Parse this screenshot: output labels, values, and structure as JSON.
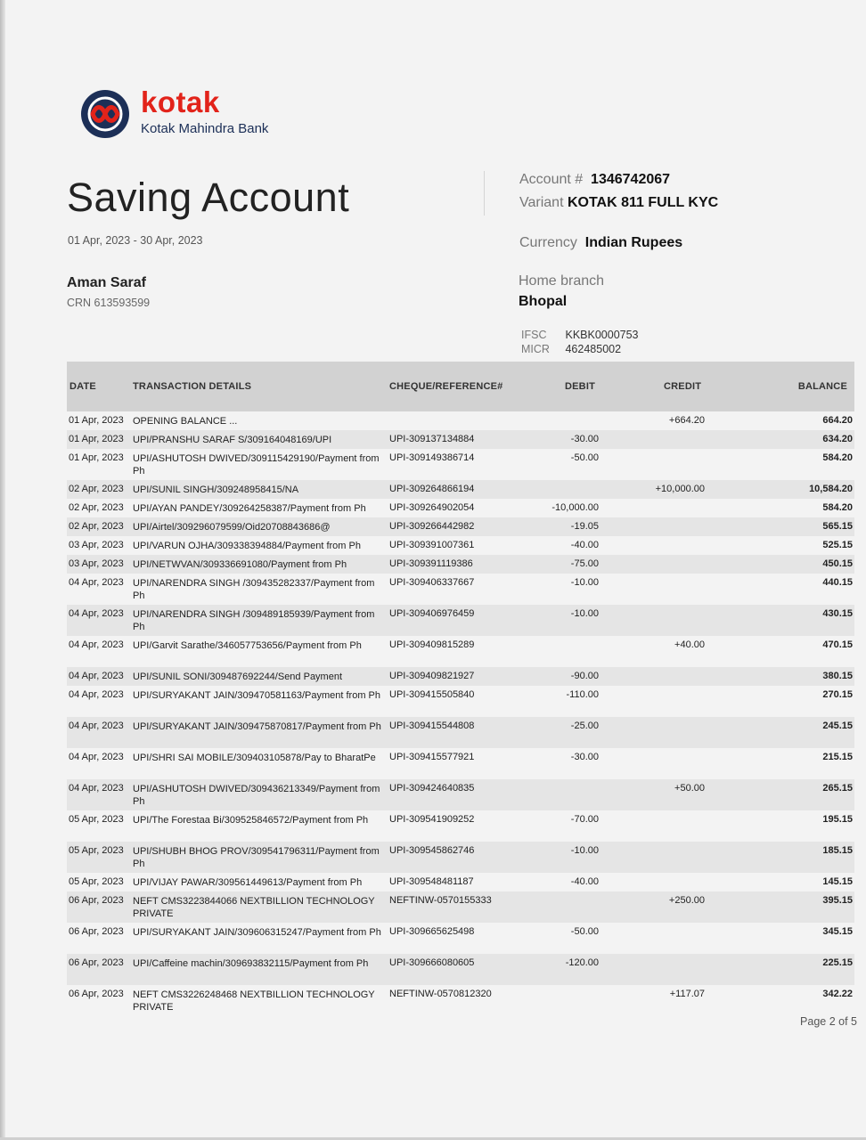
{
  "bank": {
    "logo_word": "kotak",
    "logo_sub": "Kotak Mahindra Bank",
    "brand_red": "#e2231a",
    "brand_navy": "#1c2f57"
  },
  "statement": {
    "title": "Saving Account",
    "period": "01 Apr, 2023 - 30 Apr, 2023",
    "holder_name": "Aman Saraf",
    "crn": "CRN 613593599"
  },
  "account": {
    "number_label": "Account #",
    "number": "1346742067",
    "variant_label": "Variant",
    "variant": "KOTAK 811 FULL KYC",
    "currency_label": "Currency",
    "currency": "Indian Rupees",
    "home_branch_label": "Home branch",
    "home_branch": "Bhopal",
    "ifsc_label": "IFSC",
    "ifsc": "KKBK0000753",
    "micr_label": "MICR",
    "micr": "462485002"
  },
  "table": {
    "headers": {
      "date": "DATE",
      "details": "TRANSACTION DETAILS",
      "ref": "CHEQUE/REFERENCE#",
      "debit": "DEBIT",
      "credit": "CREDIT",
      "balance": "BALANCE"
    },
    "rows": [
      {
        "date": "01 Apr, 2023",
        "details": "OPENING BALANCE ...",
        "ref": "",
        "debit": "",
        "credit": "+664.20",
        "balance": "664.20"
      },
      {
        "date": "01 Apr, 2023",
        "details": "UPI/PRANSHU SARAF S/309164048169/UPI",
        "ref": "UPI-309137134884",
        "debit": "-30.00",
        "credit": "",
        "balance": "634.20"
      },
      {
        "date": "01 Apr, 2023",
        "details": "UPI/ASHUTOSH DWIVED/309115429190/Payment from Ph",
        "ref": "UPI-309149386714",
        "debit": "-50.00",
        "credit": "",
        "balance": "584.20"
      },
      {
        "date": "02 Apr, 2023",
        "details": "UPI/SUNIL  SINGH/309248958415/NA",
        "ref": "UPI-309264866194",
        "debit": "",
        "credit": "+10,000.00",
        "balance": "10,584.20"
      },
      {
        "date": "02 Apr, 2023",
        "details": "UPI/AYAN PANDEY/309264258387/Payment from Ph",
        "ref": "UPI-309264902054",
        "debit": "-10,000.00",
        "credit": "",
        "balance": "584.20"
      },
      {
        "date": "02 Apr, 2023",
        "details": "UPI/Airtel/309296079599/Oid20708843686@",
        "ref": "UPI-309266442982",
        "debit": "-19.05",
        "credit": "",
        "balance": "565.15"
      },
      {
        "date": "03 Apr, 2023",
        "details": "UPI/VARUN OJHA/309338394884/Payment from Ph",
        "ref": "UPI-309391007361",
        "debit": "-40.00",
        "credit": "",
        "balance": "525.15"
      },
      {
        "date": "03 Apr, 2023",
        "details": "UPI/NETWVAN/309336691080/Payment from Ph",
        "ref": "UPI-309391119386",
        "debit": "-75.00",
        "credit": "",
        "balance": "450.15"
      },
      {
        "date": "04 Apr, 2023",
        "details": "UPI/NARENDRA SINGH /309435282337/Payment from Ph",
        "ref": "UPI-309406337667",
        "debit": "-10.00",
        "credit": "",
        "balance": "440.15"
      },
      {
        "date": "04 Apr, 2023",
        "details": "UPI/NARENDRA SINGH /309489185939/Payment from Ph",
        "ref": "UPI-309406976459",
        "debit": "-10.00",
        "credit": "",
        "balance": "430.15"
      },
      {
        "date": "04 Apr, 2023",
        "details": "UPI/Garvit  Sarathe/346057753656/Payment from Ph",
        "ref": "UPI-309409815289",
        "debit": "",
        "credit": "+40.00",
        "balance": "470.15"
      },
      {
        "date": "04 Apr, 2023",
        "details": "UPI/SUNIL SONI/309487692244/Send Payment",
        "ref": "UPI-309409821927",
        "debit": "-90.00",
        "credit": "",
        "balance": "380.15"
      },
      {
        "date": "04 Apr, 2023",
        "details": "UPI/SURYAKANT JAIN/309470581163/Payment from Ph",
        "ref": "UPI-309415505840",
        "debit": "-110.00",
        "credit": "",
        "balance": "270.15"
      },
      {
        "date": "04 Apr, 2023",
        "details": "UPI/SURYAKANT JAIN/309475870817/Payment from Ph",
        "ref": "UPI-309415544808",
        "debit": "-25.00",
        "credit": "",
        "balance": "245.15"
      },
      {
        "date": "04 Apr, 2023",
        "details": "UPI/SHRI SAI MOBILE/309403105878/Pay to BharatPe",
        "ref": "UPI-309415577921",
        "debit": "-30.00",
        "credit": "",
        "balance": "215.15"
      },
      {
        "date": "04 Apr, 2023",
        "details": "UPI/ASHUTOSH DWIVED/309436213349/Payment from Ph",
        "ref": "UPI-309424640835",
        "debit": "",
        "credit": "+50.00",
        "balance": "265.15"
      },
      {
        "date": "05 Apr, 2023",
        "details": "UPI/The Forestaa Bi/309525846572/Payment from Ph",
        "ref": "UPI-309541909252",
        "debit": "-70.00",
        "credit": "",
        "balance": "195.15"
      },
      {
        "date": "05 Apr, 2023",
        "details": "UPI/SHUBH BHOG PROV/309541796311/Payment from Ph",
        "ref": "UPI-309545862746",
        "debit": "-10.00",
        "credit": "",
        "balance": "185.15"
      },
      {
        "date": "05 Apr, 2023",
        "details": "UPI/VIJAY PAWAR/309561449613/Payment from Ph",
        "ref": "UPI-309548481187",
        "debit": "-40.00",
        "credit": "",
        "balance": "145.15"
      },
      {
        "date": "06 Apr, 2023",
        "details": "NEFT CMS3223844066 NEXTBILLION TECHNOLOGY PRIVATE",
        "ref": "NEFTINW-0570155333",
        "debit": "",
        "credit": "+250.00",
        "balance": "395.15"
      },
      {
        "date": "06 Apr, 2023",
        "details": "UPI/SURYAKANT JAIN/309606315247/Payment from Ph",
        "ref": "UPI-309665625498",
        "debit": "-50.00",
        "credit": "",
        "balance": "345.15"
      },
      {
        "date": "06 Apr, 2023",
        "details": "UPI/Caffeine machin/309693832115/Payment from Ph",
        "ref": "UPI-309666080605",
        "debit": "-120.00",
        "credit": "",
        "balance": "225.15"
      },
      {
        "date": "06 Apr, 2023",
        "details": "NEFT CMS3226248468 NEXTBILLION TECHNOLOGY PRIVATE",
        "ref": "NEFTINW-0570812320",
        "debit": "",
        "credit": "+117.07",
        "balance": "342.22"
      }
    ]
  },
  "footer": {
    "page": "Page 2 of 5"
  }
}
